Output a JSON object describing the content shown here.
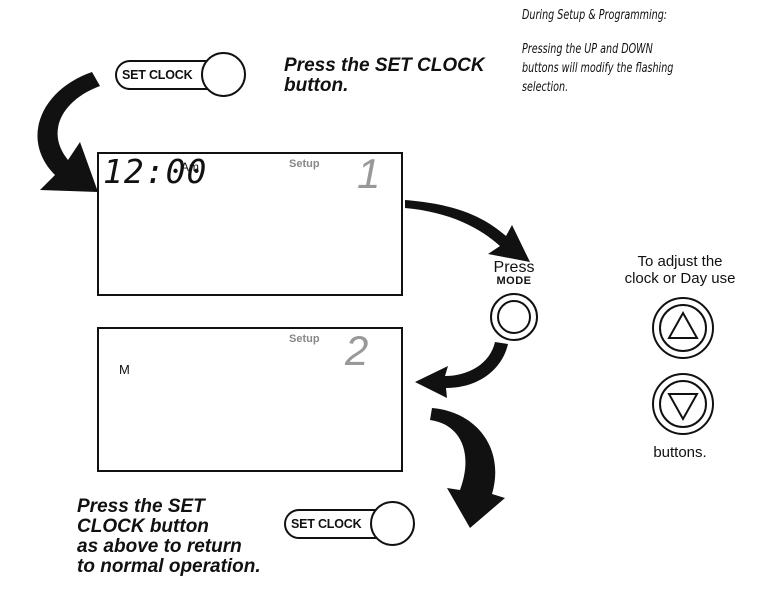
{
  "note": {
    "heading": "During Setup & Programming:",
    "line1": "Pressing the UP and DOWN",
    "line2": "buttons will modify the flashing",
    "line3": "selection."
  },
  "step1": {
    "button_label": "SET CLOCK",
    "instruction_line1": "Press the SET CLOCK",
    "instruction_line2": "button."
  },
  "display1": {
    "time": "12:00",
    "ampm": "Am",
    "setup_label": "Setup",
    "step_number": "1"
  },
  "mode": {
    "press_label": "Press",
    "mode_label": "MODE"
  },
  "display2": {
    "day": "M",
    "setup_label": "Setup",
    "step_number": "2"
  },
  "adjust": {
    "line1": "To adjust the",
    "line2": "clock or Day use",
    "footer": "buttons."
  },
  "step_final": {
    "button_label": "SET CLOCK",
    "line1": "Press the SET",
    "line2": "CLOCK button",
    "line3": "as above to return",
    "line4": "to normal operation."
  }
}
